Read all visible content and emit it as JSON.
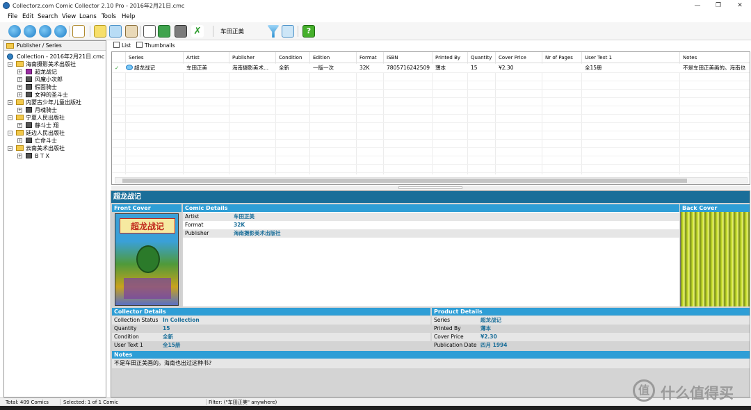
{
  "window": {
    "title": "Collectorz.com Comic Collector 2.10 Pro - 2016年2月21日.cmc",
    "controls": [
      "—",
      "❐",
      "✕"
    ]
  },
  "menu": [
    "File",
    "Edit",
    "Search",
    "View",
    "Loans",
    "Tools",
    "Help"
  ],
  "toolbar": {
    "filter_text": "车田正美",
    "icons": [
      "add-online-icon",
      "add-online-2-icon",
      "edit-online-icon",
      "remove-online-icon",
      "edit-icon",
      "list-view-icon",
      "details-view-icon",
      "book-view-icon",
      "report-icon",
      "sort-icon",
      "print-icon",
      "validate-icon",
      "filter-icon",
      "filter-active-icon",
      "help-icon"
    ]
  },
  "left": {
    "header": "Publisher / Series",
    "root": "Collection - 2016年2月21日.cmc",
    "tree": [
      {
        "label": "海南摄影美术出版社",
        "children": [
          "超龙战记",
          "风魔小次郎",
          "假面骑士",
          "女神的圣斗士"
        ]
      },
      {
        "label": "内蒙古少年儿童出版社",
        "children": [
          "月魂骑士"
        ]
      },
      {
        "label": "宁夏人民出版社",
        "children": [
          "静斗士 翔"
        ]
      },
      {
        "label": "延边人民出版社",
        "children": [
          "亡命斗士"
        ]
      },
      {
        "label": "云南美术出版社",
        "children": [
          "B T X"
        ]
      }
    ]
  },
  "tabs": {
    "list": "List",
    "thumbnails": "Thumbnails"
  },
  "grid": {
    "columns": [
      "Series",
      "Artist",
      "Publisher",
      "Condition",
      "Edition",
      "Format",
      "ISBN",
      "Printed By",
      "Quantity",
      "Cover Price",
      "Nr of Pages",
      "User Text 1",
      "Notes"
    ],
    "rows": [
      [
        "超龙战记",
        "车田正美",
        "海南摄影美术...",
        "全新",
        "一版一次",
        "32K",
        "7805716242509",
        "薄本",
        "15",
        "¥2.30",
        "",
        "全15册",
        "不是车田正美画的。海南也"
      ]
    ],
    "check_mark": "✓"
  },
  "detail": {
    "title": "超龙战记",
    "front_cover_label": "Front Cover",
    "back_cover_label": "Back Cover",
    "front_cover_title": "超龙战记",
    "comic_details": {
      "header": "Comic Details",
      "rows": [
        {
          "key": "Artist",
          "value": "车田正美"
        },
        {
          "key": "Format",
          "value": "32K"
        },
        {
          "key": "Publisher",
          "value": "海南摄影美术出版社"
        }
      ]
    },
    "collector_details": {
      "header": "Collector Details",
      "rows": [
        {
          "key": "Collection Status",
          "value": "In Collection"
        },
        {
          "key": "Quantity",
          "value": "15"
        },
        {
          "key": "Condition",
          "value": "全新"
        },
        {
          "key": "User Text 1",
          "value": "全15册"
        }
      ]
    },
    "product_details": {
      "header": "Product Details",
      "rows": [
        {
          "key": "Series",
          "value": "超龙战记"
        },
        {
          "key": "Printed By",
          "value": "薄本"
        },
        {
          "key": "Cover Price",
          "value": "¥2.30"
        },
        {
          "key": "Publication Date",
          "value": "四月 1994"
        }
      ]
    },
    "notes": {
      "header": "Notes",
      "text": "不是车田正美画的。海南也出过这种书?"
    }
  },
  "status": {
    "total": "Total: 409 Comics",
    "selected": "Selected: 1 of 1 Comic",
    "filter": "Filter: (\"车田正美\" anywhere)"
  },
  "watermark": {
    "glyph": "值",
    "text": "什么值得买"
  },
  "colors": {
    "detail_title_bg": "#1a6e99",
    "section_header_bg": "#2e9ed6",
    "value_text": "#1a6e99"
  }
}
